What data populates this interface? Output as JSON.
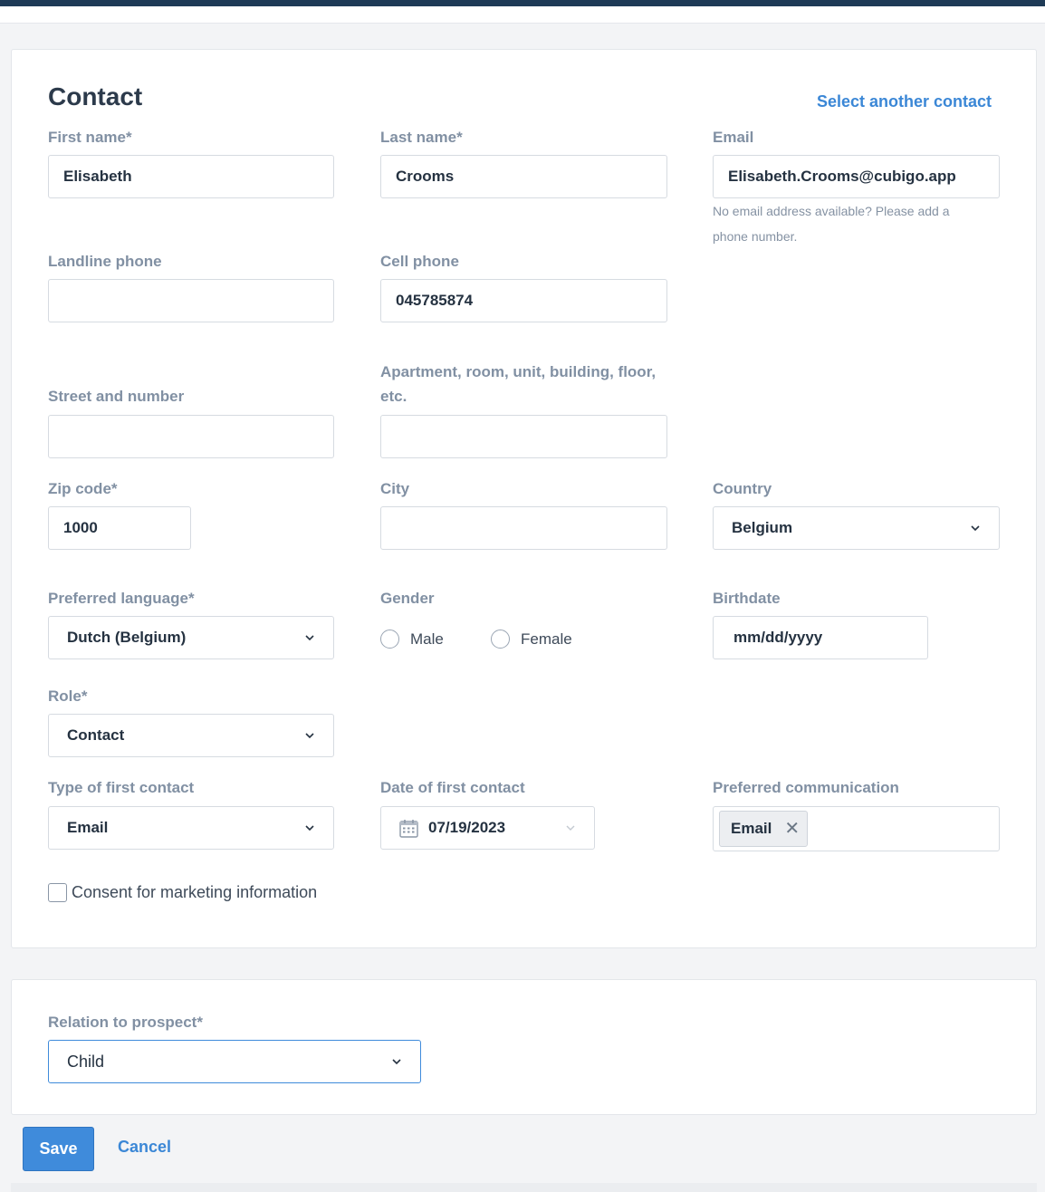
{
  "contact": {
    "title": "Contact",
    "select_another": "Select another contact",
    "first_name": {
      "label": "First name*",
      "value": "Elisabeth"
    },
    "last_name": {
      "label": "Last name*",
      "value": "Crooms"
    },
    "email": {
      "label": "Email",
      "value": "Elisabeth.Crooms@cubigo.app",
      "hint": "No email address available? Please add a phone number."
    },
    "landline": {
      "label": "Landline phone",
      "value": ""
    },
    "cell": {
      "label": "Cell phone",
      "value": "045785874"
    },
    "street": {
      "label": "Street and number",
      "value": ""
    },
    "apartment": {
      "label": "Apartment, room, unit, building, floor, etc.",
      "value": ""
    },
    "zip": {
      "label": "Zip code*",
      "value": "1000"
    },
    "city": {
      "label": "City",
      "value": ""
    },
    "country": {
      "label": "Country",
      "value": "Belgium"
    },
    "language": {
      "label": "Preferred language*",
      "value": "Dutch (Belgium)"
    },
    "gender": {
      "label": "Gender",
      "options": [
        "Male",
        "Female"
      ]
    },
    "birthdate": {
      "label": "Birthdate",
      "placeholder": "mm/dd/yyyy"
    },
    "role": {
      "label": "Role*",
      "value": "Contact"
    },
    "first_contact_type": {
      "label": "Type of first contact",
      "value": "Email"
    },
    "first_contact_date": {
      "label": "Date of first contact",
      "value": "07/19/2023"
    },
    "preferred_communication": {
      "label": "Preferred communication",
      "tags": [
        "Email"
      ]
    },
    "consent": {
      "label": "Consent for marketing information",
      "checked": false
    }
  },
  "relation": {
    "label": "Relation to prospect*",
    "value": "Child"
  },
  "actions": {
    "save": "Save",
    "cancel": "Cancel"
  },
  "colors": {
    "primary": "#3f8bdb",
    "link": "#3b87d6",
    "topbar": "#1e3a56"
  }
}
